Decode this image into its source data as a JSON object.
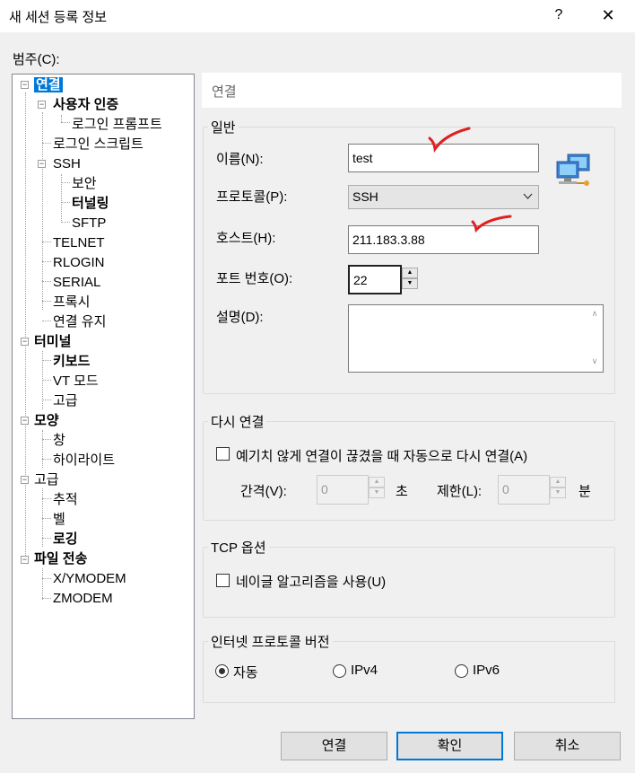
{
  "window": {
    "title": "새 세션 등록 정보",
    "help_label": "?",
    "close_label": "✕"
  },
  "category_label": "범주(C):",
  "tree": {
    "items": [
      {
        "label": "연결"
      },
      {
        "label": "사용자 인증"
      },
      {
        "label": "로그인 프롬프트"
      },
      {
        "label": "로그인 스크립트"
      },
      {
        "label": "SSH"
      },
      {
        "label": "보안"
      },
      {
        "label": "터널링"
      },
      {
        "label": "SFTP"
      },
      {
        "label": "TELNET"
      },
      {
        "label": "RLOGIN"
      },
      {
        "label": "SERIAL"
      },
      {
        "label": "프록시"
      },
      {
        "label": "연결 유지"
      },
      {
        "label": "터미널"
      },
      {
        "label": "키보드"
      },
      {
        "label": "VT 모드"
      },
      {
        "label": "고급"
      },
      {
        "label": "모양"
      },
      {
        "label": "창"
      },
      {
        "label": "하이라이트"
      },
      {
        "label": "고급"
      },
      {
        "label": "추적"
      },
      {
        "label": "벨"
      },
      {
        "label": "로깅"
      },
      {
        "label": "파일 전송"
      },
      {
        "label": "X/YMODEM"
      },
      {
        "label": "ZMODEM"
      }
    ]
  },
  "header": {
    "title": "연결"
  },
  "general": {
    "group_title": "일반",
    "name_label": "이름(N):",
    "name_value": "test",
    "protocol_label": "프로토콜(P):",
    "protocol_value": "SSH",
    "host_label": "호스트(H):",
    "host_value": "211.183.3.88",
    "port_label": "포트 번호(O):",
    "port_value": "22",
    "desc_label": "설명(D):",
    "desc_value": ""
  },
  "reconnect": {
    "group_title": "다시 연결",
    "checkbox_label": "예기치 않게 연결이 끊겼을 때 자동으로 다시 연결(A)",
    "checked": false,
    "interval_label": "간격(V):",
    "interval_value": "0",
    "interval_unit": "초",
    "limit_label": "제한(L):",
    "limit_value": "0",
    "limit_unit": "분"
  },
  "tcp": {
    "group_title": "TCP 옵션",
    "nagle_label": "네이글 알고리즘을 사용(U)",
    "checked": false
  },
  "ip_version": {
    "group_title": "인터넷 프로토콜 버전",
    "options": [
      {
        "label": "자동",
        "selected": true
      },
      {
        "label": "IPv4",
        "selected": false
      },
      {
        "label": "IPv6",
        "selected": false
      }
    ]
  },
  "buttons": {
    "connect": "연결",
    "ok": "확인",
    "cancel": "취소"
  },
  "colors": {
    "selection": "#0078d7",
    "annotation": "#e02020"
  },
  "icons": {
    "session": "network-computer-icon"
  }
}
